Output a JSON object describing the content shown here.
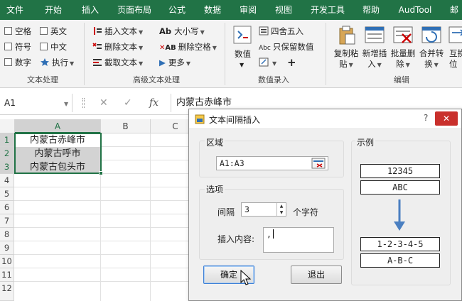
{
  "ribbon_tabs": [
    {
      "label": "文件"
    },
    {
      "label": "开始"
    },
    {
      "label": "插入"
    },
    {
      "label": "页面布局"
    },
    {
      "label": "公式"
    },
    {
      "label": "数据"
    },
    {
      "label": "审阅"
    },
    {
      "label": "视图"
    },
    {
      "label": "开发工具"
    },
    {
      "label": "帮助"
    },
    {
      "label": "AudTool"
    },
    {
      "label": "邮"
    }
  ],
  "ribbon": {
    "group_text": {
      "label": "文本处理",
      "checks": [
        {
          "label": "空格"
        },
        {
          "label": "英文"
        },
        {
          "label": "符号"
        },
        {
          "label": "中文"
        },
        {
          "label": "数字"
        }
      ],
      "execute_label": "执行"
    },
    "group_adv": {
      "label": "高级文本处理",
      "items": [
        {
          "label": "插入文本"
        },
        {
          "label": "删除文本"
        },
        {
          "label": "截取文本"
        },
        {
          "label": "大小写"
        },
        {
          "label": "删除空格"
        },
        {
          "label": "更多"
        }
      ]
    },
    "group_num": {
      "label": "数值录入",
      "value_label": "数值",
      "round_label": "四舍五入",
      "keep_label": "只保留数值",
      "abc_glyph": "Abc",
      "plus_glyph": "+"
    },
    "group_edit": {
      "label": "编辑",
      "buttons": [
        {
          "line1": "复制粘",
          "line2": "贴"
        },
        {
          "line1": "新增插",
          "line2": "入"
        },
        {
          "line1": "批量删",
          "line2": "除"
        },
        {
          "line1": "合并转",
          "line2": "换"
        },
        {
          "line1": "互换",
          "line2": "位"
        }
      ]
    }
  },
  "formula_bar": {
    "name_box": "A1",
    "cancel_glyph": "✕",
    "confirm_glyph": "✓",
    "fx_glyph": "fx",
    "value": "内蒙古赤峰市"
  },
  "sheet": {
    "columns": [
      "A",
      "B",
      "C"
    ],
    "rows": [
      "1",
      "2",
      "3",
      "4",
      "5",
      "6",
      "7",
      "8",
      "9",
      "10",
      "11",
      "12"
    ],
    "cells": [
      "内蒙古赤峰市",
      "内蒙古呼市",
      "内蒙古包头市"
    ]
  },
  "dialog": {
    "title": "文本间隔插入",
    "help_glyph": "?",
    "close_glyph": "✕",
    "area_label": "区域",
    "area_value": "A1:A3",
    "options_label": "选项",
    "interval_label": "间隔",
    "interval_value": "3",
    "interval_unit": "个字符",
    "insert_label": "插入内容:",
    "insert_value": ",",
    "example_label": "示例",
    "example_before": [
      "12345",
      "ABC"
    ],
    "example_after": [
      "1-2-3-4-5",
      "A-B-C"
    ],
    "ok_label": "确定",
    "cancel_label": "退出"
  },
  "colors": {
    "excel_green": "#217346",
    "selection_border": "#217346",
    "arrow_blue": "#4a7fc1"
  }
}
